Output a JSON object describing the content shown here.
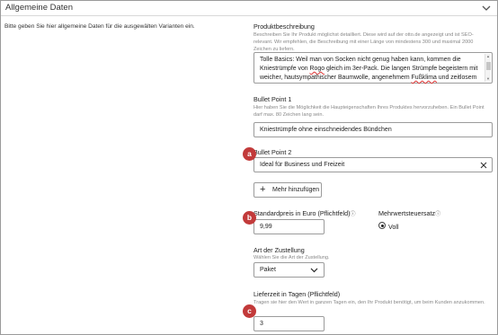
{
  "section": {
    "title": "Allgemeine Daten",
    "intro": "Bitte geben Sie hier allgemeine Daten für die ausgewälten Varianten ein."
  },
  "product_description": {
    "label": "Produktbeschreibung",
    "help": "Beschreiben Sie Ihr Produkt möglichst detailliert. Diese wird auf der otto.de angezeigt und ist SEO-relevant. Wir empfehlen, die Beschreibung mit einer Länge von mindestens 300 und maximal 2000 Zeichen zu liefern.",
    "value_part1": "Tolle Basics: Weil man von Socken nicht genug haben kann, kommen die Kniestrümpfe von ",
    "value_brand": "Rogo",
    "value_part2": " gleich im 3er-Pack. Die langen Strümpfe begeistern mit weicher, hautsympathischer Baumwolle, angenehmem ",
    "value_word": "Fußklima",
    "value_part3": " und zeitlosem"
  },
  "bullet_point_1": {
    "label": "Bullet Point 1",
    "help": "Hier haben Sie die Möglichkeit die Haupteigenschaften Ihres Produktes hervorzuheben. Ein Bullet Point darf max. 80 Zeichen lang sein.",
    "value": "Kniestrümpfe ohne einschneidendes Bündchen"
  },
  "bullet_point_2": {
    "label": "Bullet Point 2",
    "value": "Ideal für Business und Freizeit"
  },
  "add_more_button": {
    "label": "Mehr hinzufügen"
  },
  "price": {
    "label": "Standardpreis in Euro (Pflichtfeld)",
    "value": "9,99"
  },
  "vat": {
    "label": "Mehrwertsteuersatz",
    "option_label": "Voll",
    "selected": true
  },
  "delivery_type": {
    "label": "Art der Zustellung",
    "help": "Wählen Sie die Art der Zustellung.",
    "selected": "Paket"
  },
  "delivery_time": {
    "label": "Lieferzeit in Tagen (Pflichtfeld)",
    "help": "Tragen sie hier den Wert in ganzen Tagen ein, den Ihr Produkt benötigt, um beim Kunden anzukommen.",
    "value": "3"
  },
  "markers": {
    "a": "a",
    "b": "b",
    "c": "c"
  },
  "icons": {
    "collapse": "chevron-down-icon",
    "clear": "close-icon",
    "add": "plus-icon",
    "info": "info-icon",
    "dropdown": "chevron-down-icon"
  },
  "colors": {
    "marker": "#c23a3a",
    "border": "#9b9b9b",
    "help_text": "#888888"
  }
}
